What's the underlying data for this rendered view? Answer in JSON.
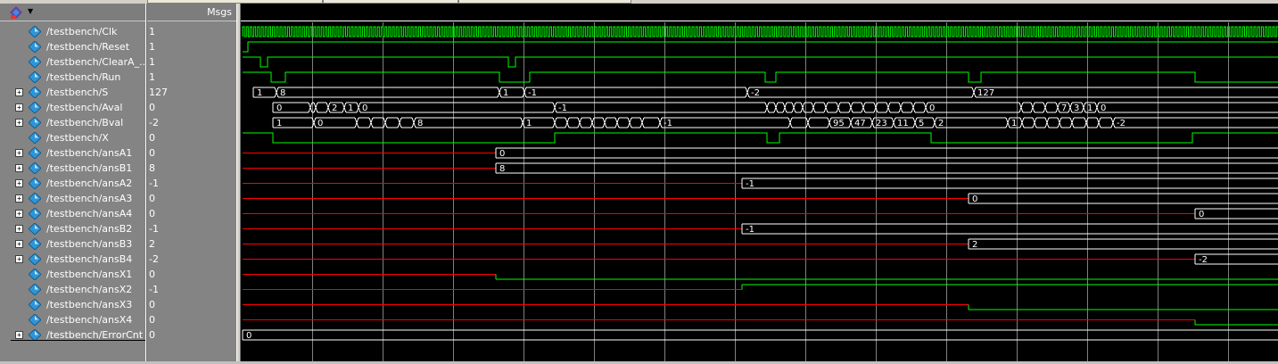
{
  "header": {
    "msgs_label": "Msgs"
  },
  "signals": [
    {
      "name": "/testbench/Clk",
      "value": "1",
      "expandable": false
    },
    {
      "name": "/testbench/Reset",
      "value": "1",
      "expandable": false
    },
    {
      "name": "/testbench/ClearA_...",
      "value": "1",
      "expandable": false
    },
    {
      "name": "/testbench/Run",
      "value": "1",
      "expandable": false
    },
    {
      "name": "/testbench/S",
      "value": "127",
      "expandable": true
    },
    {
      "name": "/testbench/Aval",
      "value": "0",
      "expandable": true
    },
    {
      "name": "/testbench/Bval",
      "value": "-2",
      "expandable": true
    },
    {
      "name": "/testbench/X",
      "value": "0",
      "expandable": false
    },
    {
      "name": "/testbench/ansA1",
      "value": "0",
      "expandable": true
    },
    {
      "name": "/testbench/ansB1",
      "value": "8",
      "expandable": true
    },
    {
      "name": "/testbench/ansA2",
      "value": "-1",
      "expandable": true
    },
    {
      "name": "/testbench/ansA3",
      "value": "0",
      "expandable": true
    },
    {
      "name": "/testbench/ansA4",
      "value": "0",
      "expandable": true
    },
    {
      "name": "/testbench/ansB2",
      "value": "-1",
      "expandable": true
    },
    {
      "name": "/testbench/ansB3",
      "value": "2",
      "expandable": true
    },
    {
      "name": "/testbench/ansB4",
      "value": "-2",
      "expandable": true
    },
    {
      "name": "/testbench/ansX1",
      "value": "0",
      "expandable": false
    },
    {
      "name": "/testbench/ansX2",
      "value": "-1",
      "expandable": false
    },
    {
      "name": "/testbench/ansX3",
      "value": "0",
      "expandable": false
    },
    {
      "name": "/testbench/ansX4",
      "value": "0",
      "expandable": false
    },
    {
      "name": "/testbench/ErrorCnt",
      "value": "0",
      "expandable": true
    }
  ],
  "waveform_labels": {
    "S": [
      "1",
      "8",
      "1",
      "-1",
      "-2",
      "127"
    ],
    "Aval": [
      "0",
      "2",
      "1",
      "0",
      "-1",
      "0",
      "7",
      "3",
      "1",
      "0"
    ],
    "Bval": [
      "1",
      "0",
      "8",
      "1",
      "-1",
      "95",
      "47",
      "23",
      "11",
      "5",
      "2",
      "1",
      "-2"
    ],
    "ansA1": "0",
    "ansB1": "8",
    "ansA2": "-1",
    "ansA3": "0",
    "ansA4": "0",
    "ansB2": "-1",
    "ansB3": "2",
    "ansB4": "-2",
    "ErrorCnt": "0"
  },
  "colors": {
    "logic_high": "#00ff00",
    "uninitialized": "#ff0000",
    "bus_value": "#ffffff",
    "grid": "#808080",
    "background": "#000000",
    "pane_bg": "#848484",
    "diamond": "#2e95d6"
  },
  "icons": {
    "toolbar": "wave-toolbar-icon",
    "signal": "signal-diamond-icon",
    "expand": "expand-plus-icon"
  }
}
